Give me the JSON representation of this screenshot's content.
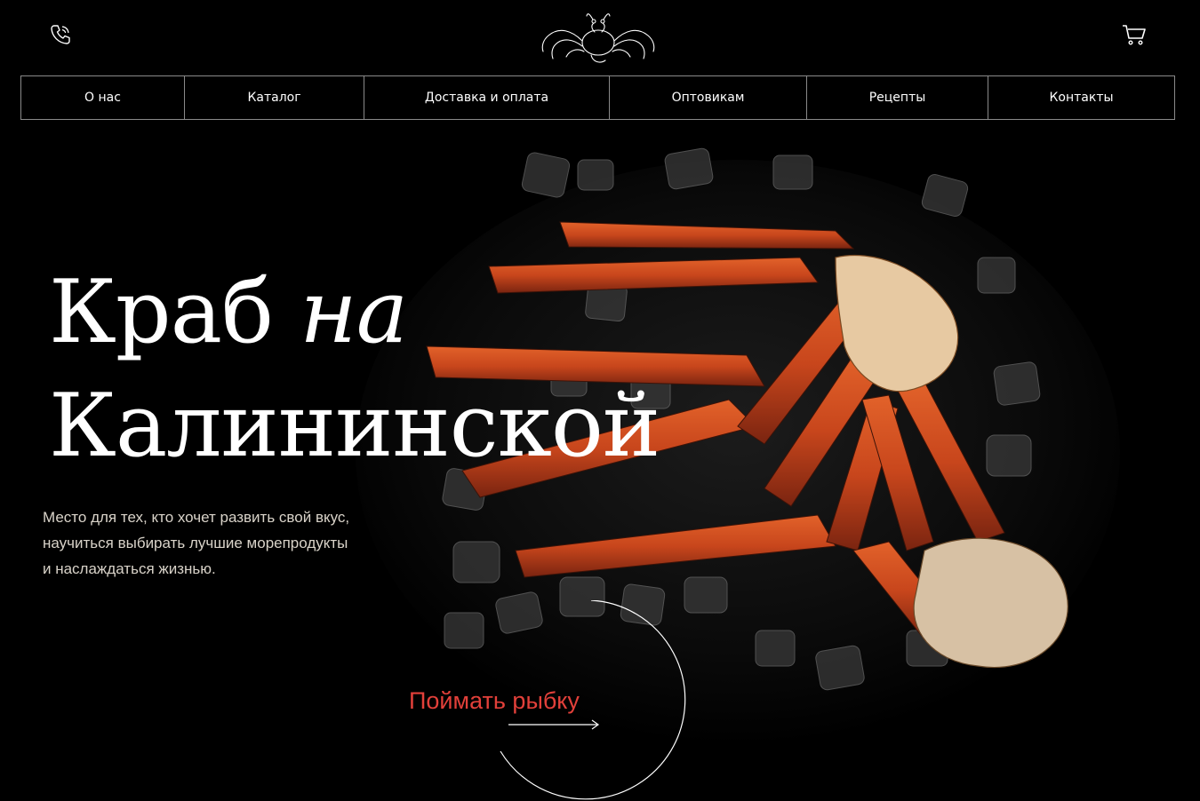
{
  "header": {
    "phone_icon": "phone-icon",
    "logo_icon": "crab-logo-icon",
    "cart_icon": "cart-icon"
  },
  "nav": {
    "items": [
      {
        "label": "О нас"
      },
      {
        "label": "Каталог"
      },
      {
        "label": "Доставка и оплата"
      },
      {
        "label": "Оптовикам"
      },
      {
        "label": "Рецепты"
      },
      {
        "label": "Контакты"
      }
    ]
  },
  "hero": {
    "title_line1_regular": "Краб",
    "title_line1_italic": "на",
    "title_line2": "Калининской",
    "subtitle_line1": "Место для тех, кто хочет развить свой вкус,",
    "subtitle_line2": "научиться выбирать лучшие морепродукты",
    "subtitle_line3": "и наслаждаться жизнью.",
    "cta_label": "Поймать рыбку"
  },
  "colors": {
    "background": "#000000",
    "accent": "#e2403a",
    "crab": "#c8461c",
    "text_muted": "#d9d3c9"
  }
}
